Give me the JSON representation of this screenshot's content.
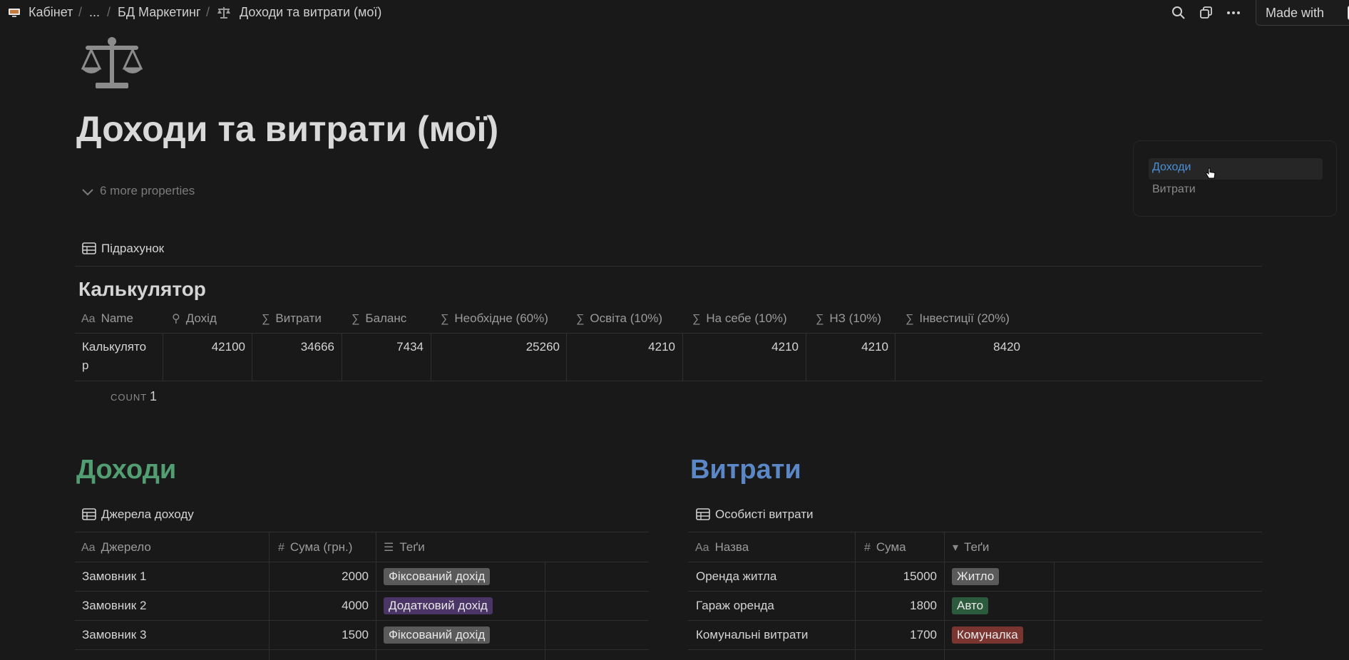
{
  "breadcrumb": {
    "items": [
      "Кабінет",
      "...",
      "БД Маркетинг",
      "Доходи та витрати (мої)"
    ]
  },
  "topbar": {
    "made_with": "Made with",
    "notion_letter": "N"
  },
  "page": {
    "title": "Доходи та витрати (мої)",
    "more_properties": "6 more properties"
  },
  "toc": {
    "items": [
      "Доходи",
      "Витрати"
    ],
    "active_color": "#4a90d9"
  },
  "summary_db": {
    "view_title": "Підрахунок",
    "heading": "Калькулятор",
    "columns": [
      "Name",
      "Дохід",
      "Витрати",
      "Баланс",
      "Необхідне (60%)",
      "Освіта (10%)",
      "На себе (10%)",
      "НЗ (10%)",
      "Інвестиції (20%)"
    ],
    "row": {
      "name_line1": "Калькулято",
      "name_line2": "р",
      "values": [
        "42100",
        "34666",
        "7434",
        "25260",
        "4210",
        "4210",
        "4210",
        "8420"
      ]
    },
    "count_label": "COUNT",
    "count_value": "1"
  },
  "income": {
    "heading": "Доходи",
    "heading_color": "#529e72",
    "view_title": "Джерела доходу",
    "columns": [
      "Джерело",
      "Сума (грн.)",
      "Теґи"
    ],
    "rows": [
      {
        "name": "Замовник 1",
        "sum": "2000",
        "tag": "Фіксований дохід",
        "tag_color": "#5a5a5a"
      },
      {
        "name": "Замовник 2",
        "sum": "4000",
        "tag": "Додатковий дохід",
        "tag_color": "#4b3466"
      },
      {
        "name": "Замовник 3",
        "sum": "1500",
        "tag": "Фіксований дохід",
        "tag_color": "#5a5a5a"
      }
    ]
  },
  "expenses": {
    "heading": "Витрати",
    "heading_color": "#5b87c7",
    "view_title": "Особисті витрати",
    "columns": [
      "Назва",
      "Сума",
      "Теґи"
    ],
    "rows": [
      {
        "name": "Оренда житла",
        "sum": "15000",
        "tag": "Житло",
        "tag_color": "#5a5a5a"
      },
      {
        "name": "Гараж оренда",
        "sum": "1800",
        "tag": "Авто",
        "tag_color": "#2b5a3c"
      },
      {
        "name": "Комунальні витрати",
        "sum": "1700",
        "tag": "Комуналка",
        "tag_color": "#7a3530"
      }
    ]
  }
}
